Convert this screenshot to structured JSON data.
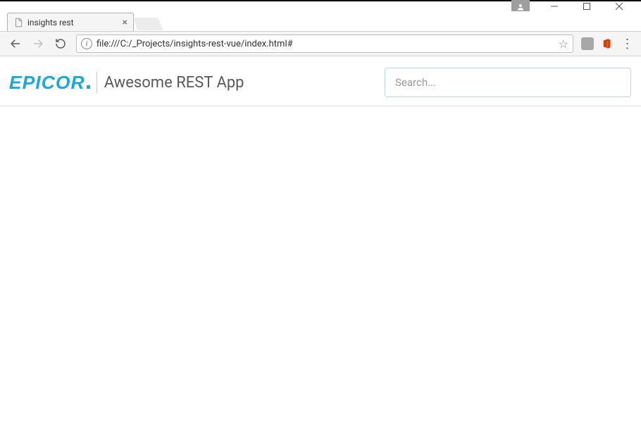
{
  "window": {
    "tab_title": "insights rest",
    "url": "file:///C:/_Projects/insights-rest-vue/index.html#"
  },
  "app": {
    "logo_text": "EPICOR",
    "title": "Awesome REST App",
    "search_placeholder": "Search..."
  },
  "icons": {
    "user": "user-icon",
    "minimize": "minimize-icon",
    "maximize": "maximize-icon",
    "close": "close-icon",
    "back": "back-icon",
    "forward": "forward-icon",
    "reload": "reload-icon",
    "bookmark": "star-icon",
    "menu": "menu-icon"
  },
  "colors": {
    "brand": "#1ba8e0",
    "office": "#d83b01"
  }
}
